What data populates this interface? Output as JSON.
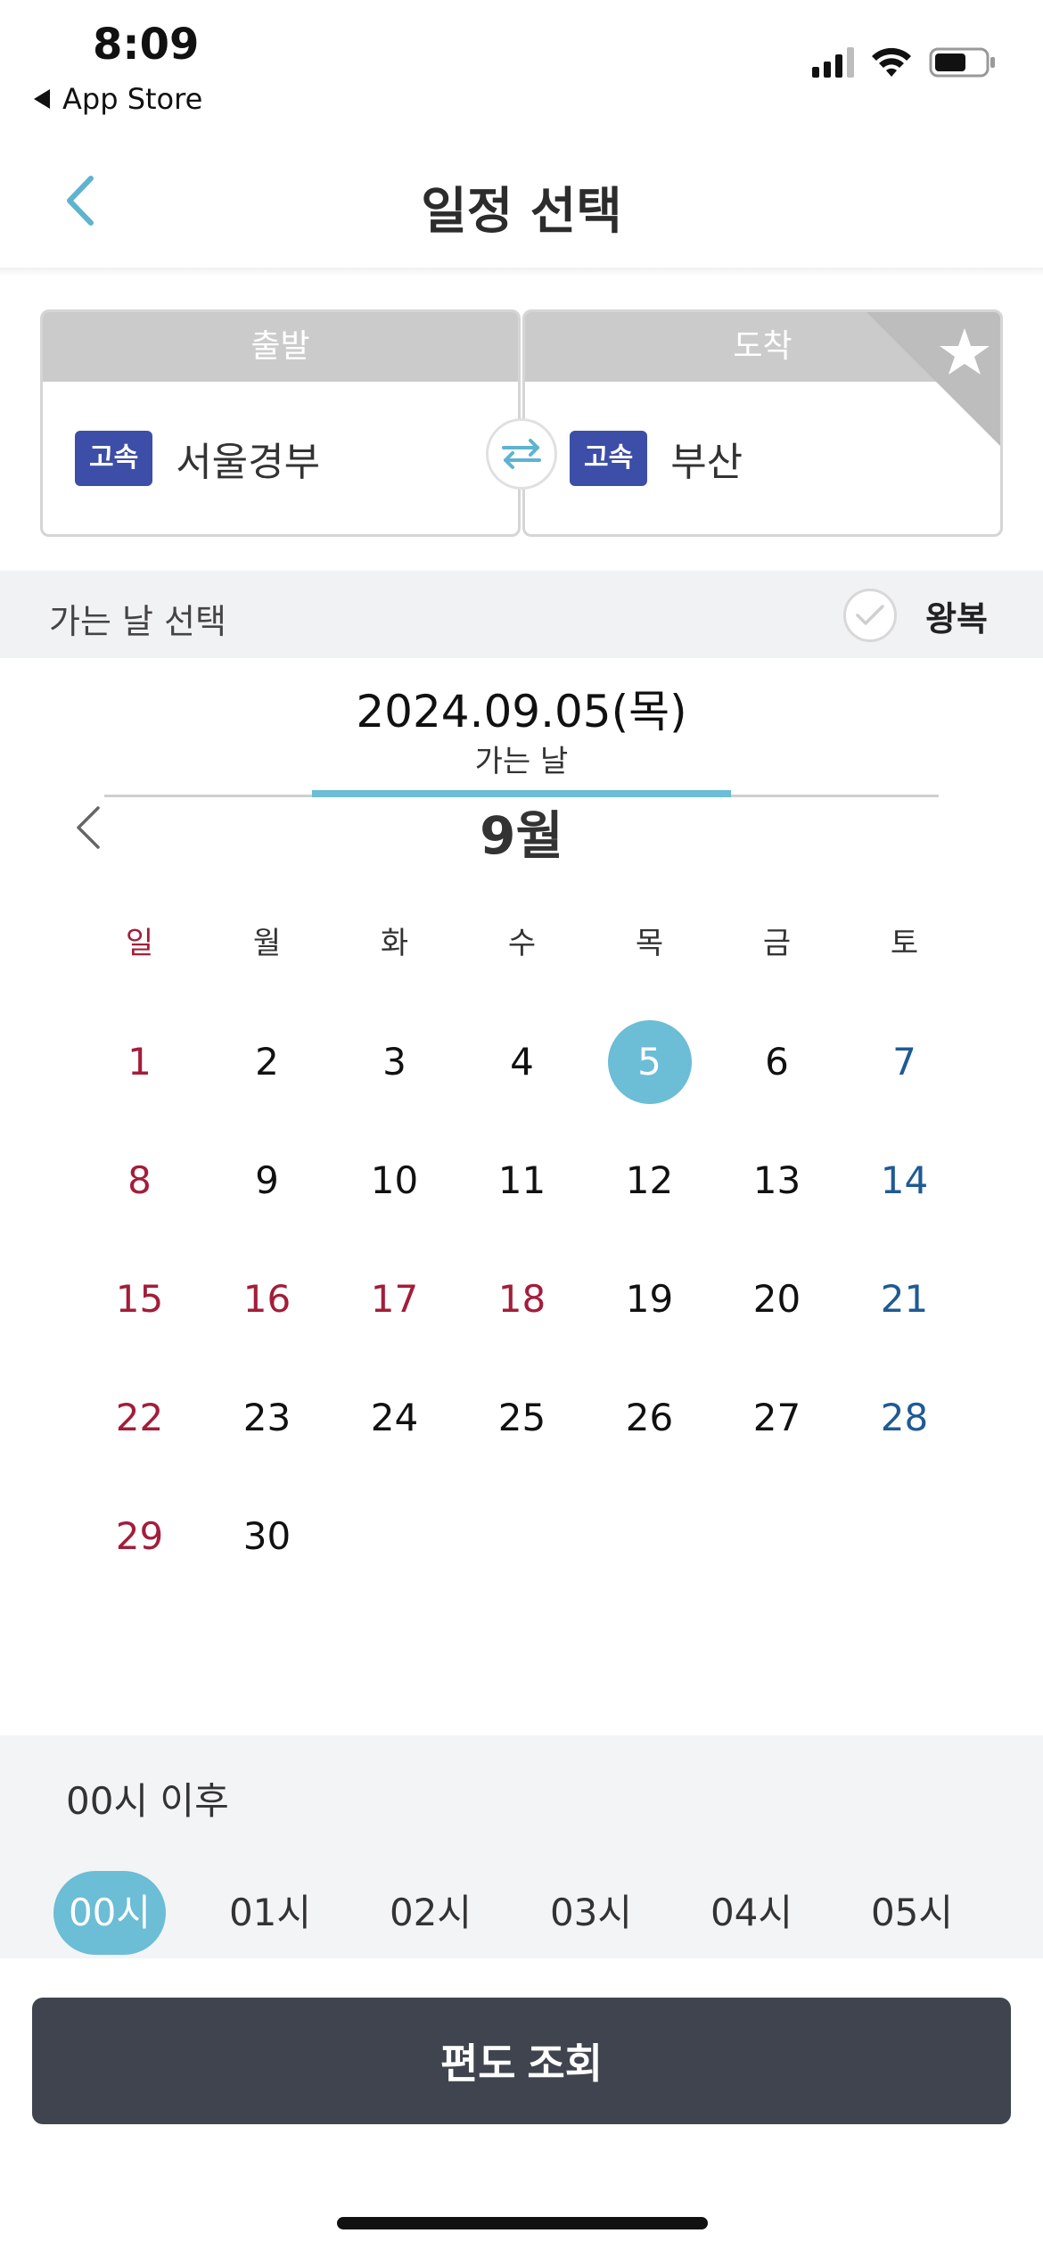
{
  "status_bar": {
    "time": "8:09",
    "back_app": "App Store"
  },
  "header": {
    "title": "일정 선택"
  },
  "route": {
    "departure_header": "출발",
    "arrival_header": "도착",
    "departure_tag": "고속",
    "departure_terminal": "서울경부",
    "arrival_tag": "고속",
    "arrival_terminal": "부산"
  },
  "date_bar": {
    "label": "가는 날 선택",
    "roundtrip_label": "왕복",
    "roundtrip_checked": false
  },
  "selected": {
    "date": "2024.09.05(목)",
    "sub_label": "가는 날"
  },
  "calendar": {
    "month_label": "9월",
    "weekdays": [
      "일",
      "월",
      "화",
      "수",
      "목",
      "금",
      "토"
    ],
    "days": [
      {
        "n": "1",
        "kind": "red"
      },
      {
        "n": "2",
        "kind": ""
      },
      {
        "n": "3",
        "kind": ""
      },
      {
        "n": "4",
        "kind": ""
      },
      {
        "n": "5",
        "kind": "selected"
      },
      {
        "n": "6",
        "kind": ""
      },
      {
        "n": "7",
        "kind": "blue"
      },
      {
        "n": "8",
        "kind": "red"
      },
      {
        "n": "9",
        "kind": ""
      },
      {
        "n": "10",
        "kind": ""
      },
      {
        "n": "11",
        "kind": ""
      },
      {
        "n": "12",
        "kind": ""
      },
      {
        "n": "13",
        "kind": ""
      },
      {
        "n": "14",
        "kind": "blue"
      },
      {
        "n": "15",
        "kind": "red"
      },
      {
        "n": "16",
        "kind": "red"
      },
      {
        "n": "17",
        "kind": "red"
      },
      {
        "n": "18",
        "kind": "red"
      },
      {
        "n": "19",
        "kind": ""
      },
      {
        "n": "20",
        "kind": ""
      },
      {
        "n": "21",
        "kind": "blue"
      },
      {
        "n": "22",
        "kind": "red"
      },
      {
        "n": "23",
        "kind": ""
      },
      {
        "n": "24",
        "kind": ""
      },
      {
        "n": "25",
        "kind": ""
      },
      {
        "n": "26",
        "kind": ""
      },
      {
        "n": "27",
        "kind": ""
      },
      {
        "n": "28",
        "kind": "blue"
      },
      {
        "n": "29",
        "kind": "red"
      },
      {
        "n": "30",
        "kind": ""
      }
    ]
  },
  "time_select": {
    "label": "00시 이후",
    "chips": [
      "00시",
      "01시",
      "02시",
      "03시",
      "04시",
      "05시"
    ],
    "active_index": 0
  },
  "action": {
    "search_label": "편도 조회"
  },
  "colors": {
    "accent": "#6cbdd6",
    "tag_bg": "#3d4ea8",
    "holiday_red": "#a31d3a",
    "saturday_blue": "#1f5a94",
    "button_dark": "#3f444e"
  },
  "icons": [
    "back-chevron-icon",
    "swap-arrows-icon",
    "star-icon",
    "check-icon",
    "prev-month-chevron-icon",
    "signal-icon",
    "wifi-icon",
    "battery-icon"
  ]
}
